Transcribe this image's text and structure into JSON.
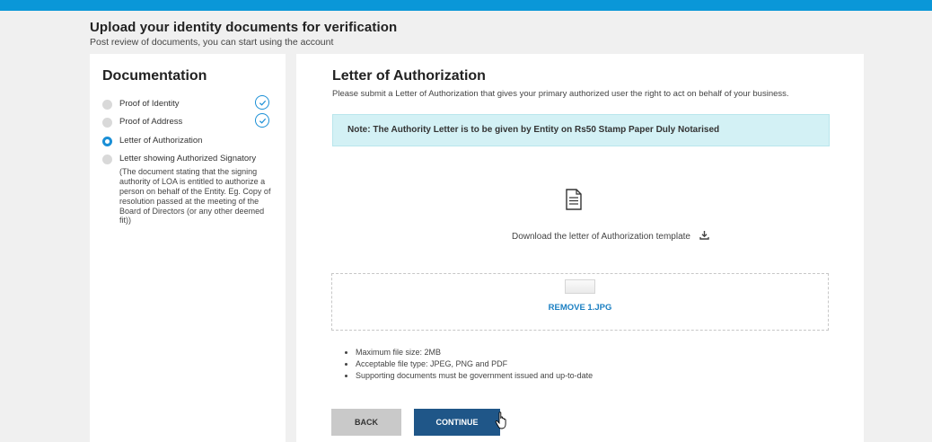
{
  "header": {
    "title": "Upload your identity documents for verification",
    "subtitle": "Post review of documents, you can start using the account"
  },
  "sidebar": {
    "title": "Documentation",
    "steps": [
      {
        "label": "Proof of Identity",
        "state": "completed"
      },
      {
        "label": "Proof of Address",
        "state": "completed"
      },
      {
        "label": "Letter of Authorization",
        "state": "active"
      },
      {
        "label": "Letter showing Authorized Signatory",
        "state": "pending",
        "description": "(The document stating that the signing authority of LOA is entitled to authorize a person on behalf of the Entity. Eg. Copy of resolution passed at the meeting of the Board of Directors (or any other deemed fit))"
      }
    ]
  },
  "main": {
    "title": "Letter of Authorization",
    "description": "Please submit a Letter of Authorization that gives your primary authorized user the right to act on behalf of your business.",
    "note": "Note: The Authority Letter is to be given by Entity on Rs50 Stamp Paper Duly Notarised",
    "download_label": "Download the letter of Authorization template",
    "uploaded_file_action": "REMOVE 1.JPG",
    "requirements": [
      "Maximum file size: 2MB",
      "Acceptable file type: JPEG, PNG and PDF",
      "Supporting documents must be government issued and up-to-date"
    ],
    "back_label": "BACK",
    "continue_label": "CONTINUE"
  },
  "colors": {
    "accent": "#0a97d8",
    "primary_button": "#1f5688",
    "note_bg": "#d3f1f5"
  }
}
